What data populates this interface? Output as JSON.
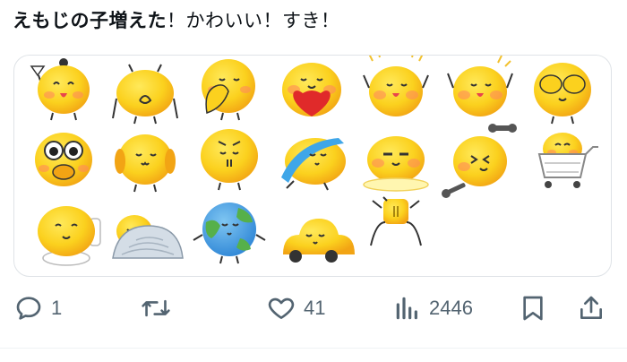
{
  "post": {
    "text_bold": "えもじの子増えた",
    "text_rest": "！かわいい！すき！"
  },
  "media": {
    "stickers": [
      "emoji-character-antenna-waving",
      "emoji-character-back-view",
      "emoji-character-hand-on-mouth",
      "emoji-character-holding-heart",
      "emoji-character-sparkle-blush",
      "emoji-character-arms-up-blush",
      "emoji-character-covering-eyes",
      "emoji-character-big-eyes-hands-on-mouth",
      "emoji-character-smug",
      "emoji-character-thinking",
      "emoji-character-blue-blanket",
      "emoji-character-flat-chill",
      "emoji-character-dumbbell",
      "emoji-character-shopping-cart",
      "emoji-character-toilet",
      "emoji-character-sleeping-under-blanket",
      "emoji-character-earth",
      "emoji-character-car",
      "emoji-character-coin-stick-figure"
    ]
  },
  "actions": {
    "reply_count": "1",
    "repost_count": "",
    "like_count": "41",
    "views_count": "2446"
  },
  "colors": {
    "emoji_yellow": "#fbd11e",
    "emoji_orange": "#f2a414",
    "blush": "#ff8a5c",
    "icon_gray": "#536471"
  }
}
